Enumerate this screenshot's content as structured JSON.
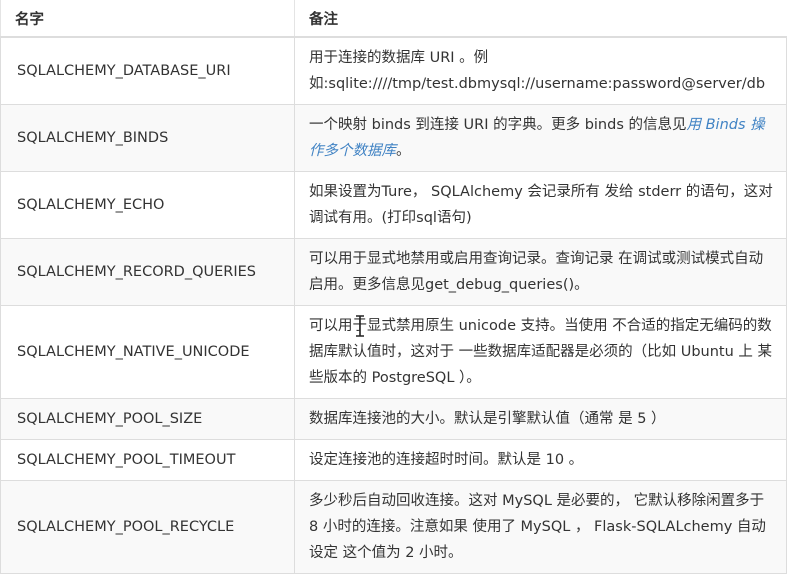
{
  "header": {
    "col_name": "名字",
    "col_note": "备注"
  },
  "rows": [
    {
      "key": "SQLALCHEMY_DATABASE_URI",
      "note": "用于连接的数据库 URI 。例如:sqlite:////tmp/test.dbmysql://username:password@server/db"
    },
    {
      "key": "SQLALCHEMY_BINDS",
      "note": "一个映射 binds 到连接 URI 的字典。更多 binds 的信息见",
      "link": "用 Binds 操作多个数据库",
      "note_end": "。"
    },
    {
      "key": "SQLALCHEMY_ECHO",
      "note": "如果设置为Ture， SQLAlchemy 会记录所有 发给 stderr 的语句，这对调试有用。(打印sql语句)"
    },
    {
      "key": "SQLALCHEMY_RECORD_QUERIES",
      "note": "可以用于显式地禁用或启用查询记录。查询记录 在调试或测试模式自动启用。更多信息见get_debug_queries()。"
    },
    {
      "key": "SQLALCHEMY_NATIVE_UNICODE",
      "note": "可以用于显式禁用原生 unicode 支持。当使用 不合适的指定无编码的数据库默认值时，这对于 一些数据库适配器是必须的（比如 Ubuntu 上 某些版本的 PostgreSQL ）。"
    },
    {
      "key": "SQLALCHEMY_POOL_SIZE",
      "note": "数据库连接池的大小。默认是引擎默认值（通常 是 5 ）"
    },
    {
      "key": "SQLALCHEMY_POOL_TIMEOUT",
      "note": "设定连接池的连接超时时间。默认是 10 。"
    },
    {
      "key": "SQLALCHEMY_POOL_RECYCLE",
      "note": "多少秒后自动回收连接。这对 MySQL 是必要的， 它默认移除闲置多于 8 小时的连接。注意如果 使用了 MySQL ， Flask-SQLALchemy 自动设定 这个值为 2 小时。"
    }
  ]
}
